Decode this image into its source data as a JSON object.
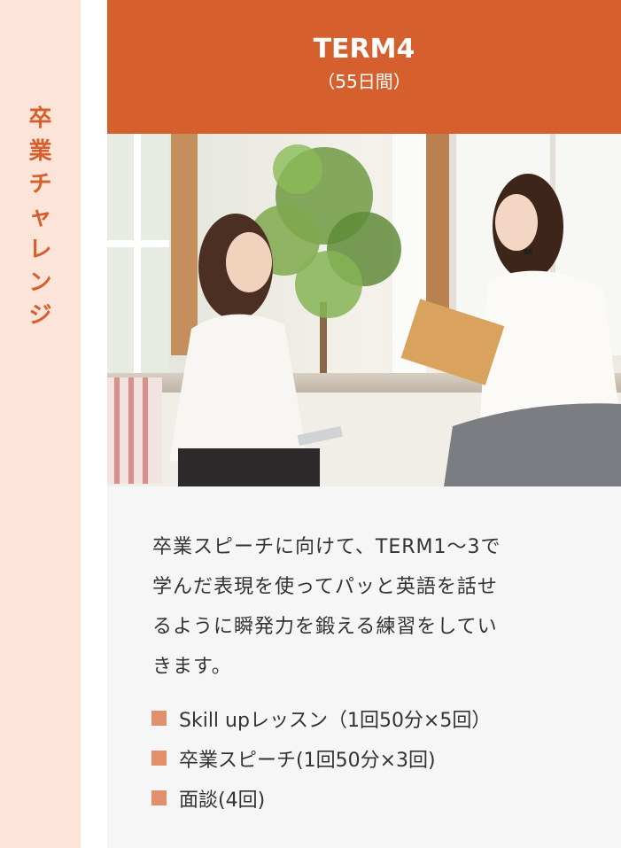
{
  "sidebar": {
    "vertical_label_chars": [
      "卒",
      "業",
      "チ",
      "ャ",
      "レ",
      "ン",
      "ジ"
    ]
  },
  "term": {
    "title": "TERM4",
    "subtitle": "（55日間）"
  },
  "photo": {
    "description_icon": "photo-image"
  },
  "description": {
    "lines": [
      "卒業スピーチに向けて、TERM1～3で",
      "学んだ表現を使ってパッと英語を話せ",
      "るように瞬発力を鍛える練習をしてい",
      "きます。"
    ]
  },
  "bullets": [
    {
      "label": "Skill upレッスン（1回50分×5回）"
    },
    {
      "label": "卒業スピーチ(1回50分×3回)"
    },
    {
      "label": "面談(4回)"
    }
  ],
  "colors": {
    "accent": "#d5602d",
    "side_band": "#fce5d8",
    "bullet": "#e2906b",
    "card_bg": "#f6f6f6"
  }
}
